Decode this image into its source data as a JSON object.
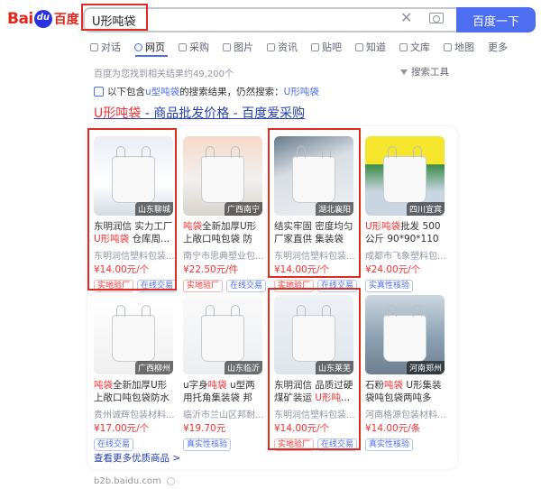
{
  "logo": {
    "text_a": "Bai",
    "text_b": "百度"
  },
  "search": {
    "query": "U形吨袋",
    "button": "百度一下"
  },
  "tabs": [
    {
      "label": "对话",
      "icon": "chat-icon"
    },
    {
      "label": "网页",
      "icon": "search-icon",
      "active": true
    },
    {
      "label": "采购",
      "icon": "cart-icon"
    },
    {
      "label": "图片",
      "icon": "image-icon"
    },
    {
      "label": "资讯",
      "icon": "news-icon"
    },
    {
      "label": "贴吧",
      "icon": "tieba-icon"
    },
    {
      "label": "知道",
      "icon": "question-icon"
    },
    {
      "label": "文库",
      "icon": "document-icon"
    },
    {
      "label": "地图",
      "icon": "map-icon"
    },
    {
      "label": "更多",
      "icon": ""
    }
  ],
  "result_count": "百度为您找到相关结果约49,200个",
  "search_tools": "搜索工具",
  "notice": {
    "prefix": "以下包含 ",
    "term": "u型吨袋",
    "middle": " 的搜索结果，仍然搜索：",
    "link": "U形吨袋"
  },
  "result": {
    "title_hl": "U形吨袋",
    "title_rest": " - 商品批发价格 - 百度爱采购"
  },
  "products": [
    {
      "location": "山东聊城",
      "name_pre": "东明润信 实力工厂 ",
      "name_hl": "U形吨袋",
      "name_post": " 仓库周...",
      "company": "东明润信塑料包装...",
      "price": "¥14.00元/个",
      "badges": [
        "实地验厂",
        "在线交易"
      ]
    },
    {
      "location": "广西南宁",
      "name_pre": "",
      "name_hl": "吨袋",
      "name_post": "全新加厚U形上敞口吨包袋 防水...",
      "company": "南宁市思典塑业包...",
      "price": "¥22.50元/件",
      "badges": [
        "实地验厂",
        "在线交易"
      ]
    },
    {
      "location": "湖北襄阳",
      "name_pre": "结实牢固 密度均匀 厂家直供 集装袋",
      "name_hl": "",
      "name_post": "",
      "company": "东明润信塑料包装...",
      "price": "¥14.00元/个",
      "badges": [
        "实地验厂",
        "在线交易"
      ]
    },
    {
      "location": "四川宜宾",
      "name_pre": "",
      "name_hl": "U形吨袋",
      "name_post": "批发 500公斤 90*90*110 加厚...",
      "company": "成都市飞象塑料包...",
      "price": "¥24.00元/个",
      "badges": [
        "实真性核验"
      ]
    },
    {
      "location": "广西柳州",
      "name_pre": "",
      "name_hl": "吨袋",
      "name_post": "全新加厚U形上敞口吨包袋防水防...",
      "company": "贵州诚辉包装材料...",
      "price": "¥17.00元/个",
      "badges": [
        "在线交易"
      ]
    },
    {
      "location": "山东临沂",
      "name_pre": "u字身",
      "name_hl": "吨袋",
      "name_post": " u型两用托角集装袋 邦耐...",
      "company": "临沂市兰山区邦耐...",
      "price": "¥19.70元",
      "badges": [
        "真实性核验"
      ]
    },
    {
      "location": "山东莱芜",
      "name_pre": "东明润信 品质过硬 煤矿装运 ",
      "name_hl": "U形吨",
      "name_post": "...",
      "company": "东明润信塑料包装...",
      "price": "¥14.00元/个",
      "badges": [
        "实地验厂",
        "在线交易"
      ]
    },
    {
      "location": "河南郑州",
      "name_pre": "石粉",
      "name_hl": "吨袋",
      "name_post": " U形集装袋吨包袋两吨多种...",
      "company": "河南格源包装材料...",
      "price": "¥14.00元/条",
      "badges": [
        "真实性核验"
      ]
    }
  ],
  "more_link": "查看更多优质商品 >",
  "site": "b2b.baidu.com"
}
